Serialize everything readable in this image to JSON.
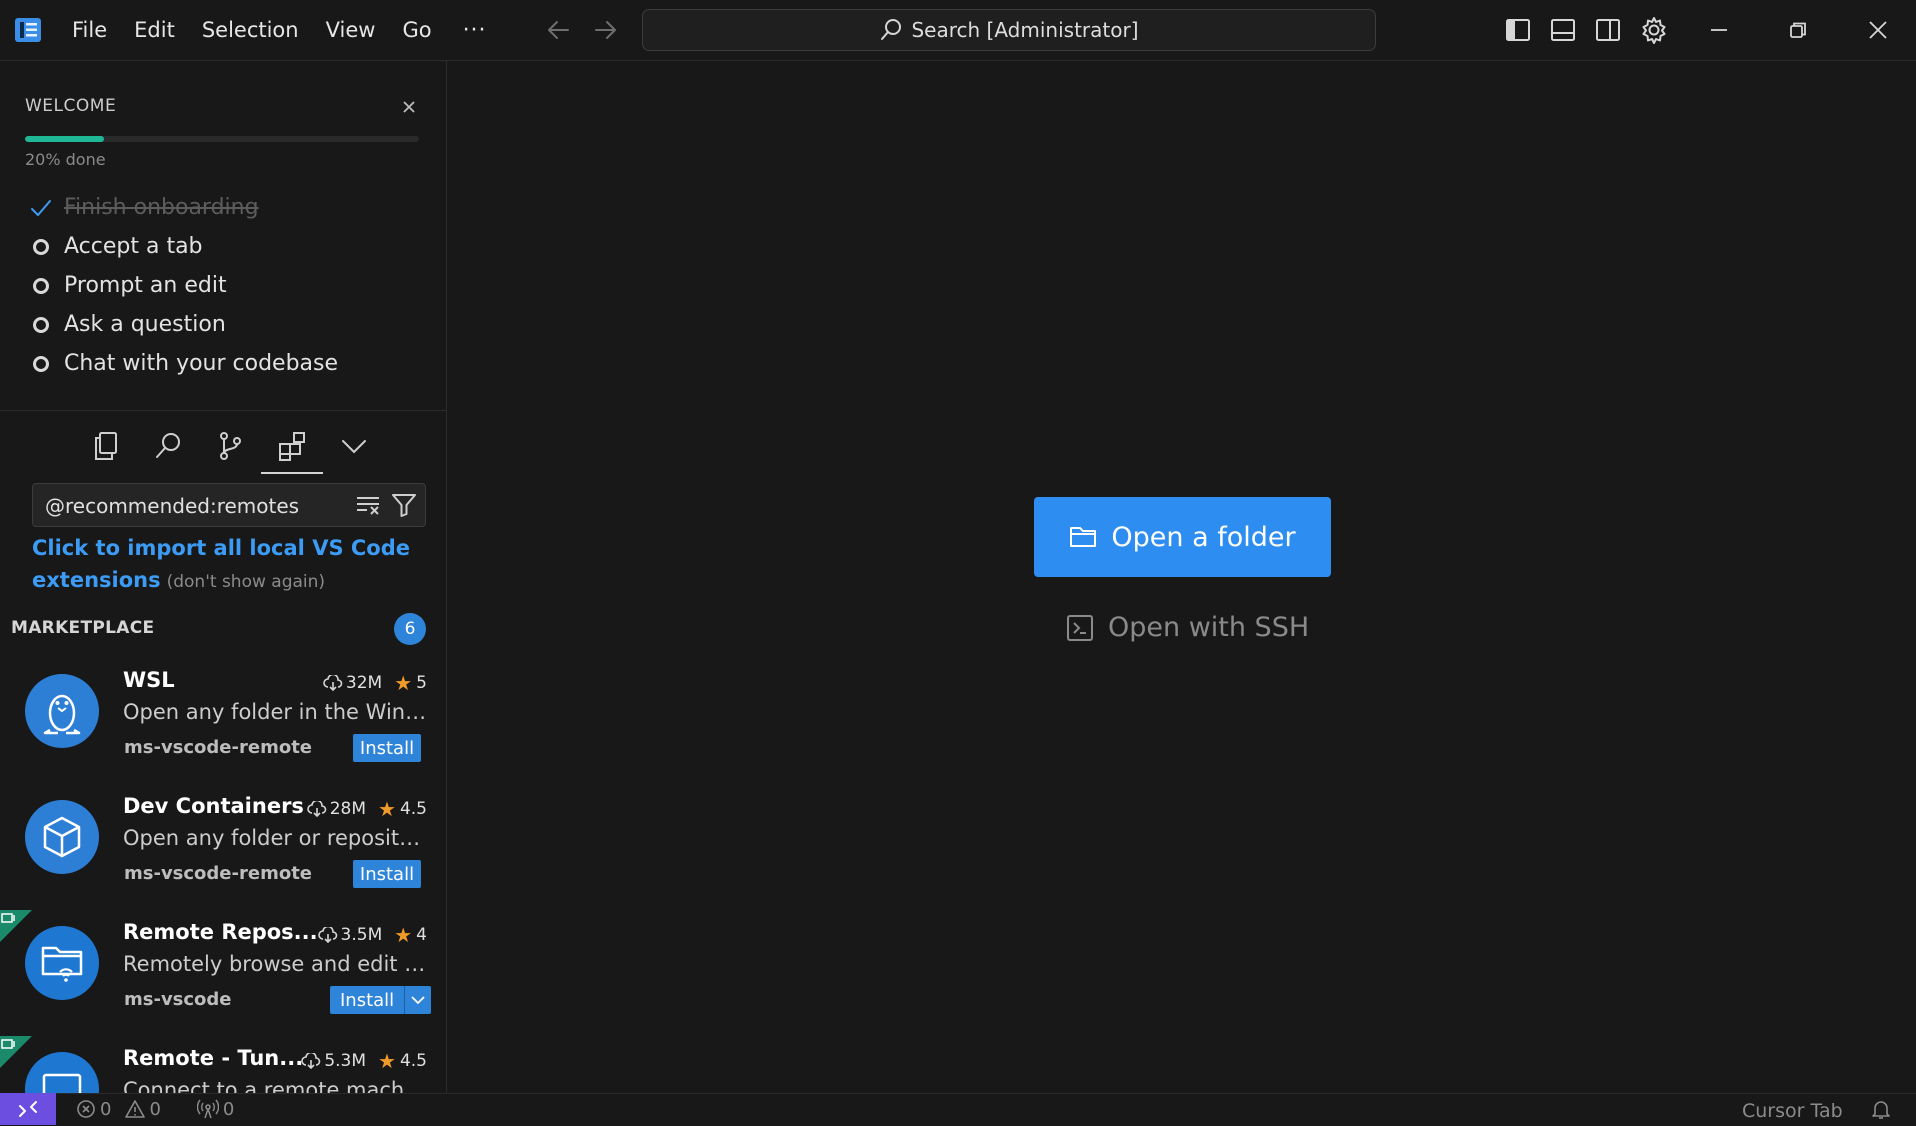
{
  "titlebar": {
    "menu": [
      "File",
      "Edit",
      "Selection",
      "View",
      "Go"
    ],
    "more": "···",
    "search": "Search [Administrator]"
  },
  "welcome": {
    "title": "WELCOME",
    "progress_percent": 20,
    "progress_text": "20% done",
    "checklist": [
      {
        "label": "Finish onboarding",
        "done": true
      },
      {
        "label": "Accept a tab",
        "done": false
      },
      {
        "label": "Prompt an edit",
        "done": false
      },
      {
        "label": "Ask a question",
        "done": false
      },
      {
        "label": "Chat with your codebase",
        "done": false
      }
    ]
  },
  "extensions": {
    "search_value": "@recommended:remotes",
    "import_link": "Click to import all local VS Code extensions",
    "dont_show": "(don't show again)",
    "section_title": "MARKETPLACE",
    "count": "6",
    "items": [
      {
        "name": "WSL",
        "downloads": "32M",
        "rating": "5",
        "description": "Open any folder in the Windows Subsystem for Linux",
        "publisher": "ms-vscode-remote",
        "install": "Install",
        "icon": "linux-penguin-icon"
      },
      {
        "name": "Dev Containers",
        "downloads": "28M",
        "rating": "4.5",
        "description": "Open any folder or repository inside a Docker container",
        "publisher": "ms-vscode-remote",
        "install": "Install",
        "icon": "container-box-icon"
      },
      {
        "name": "Remote Repos...",
        "downloads": "3.5M",
        "rating": "4",
        "description": "Remotely browse and edit git repositories",
        "publisher": "ms-vscode",
        "install": "Install",
        "icon": "remote-folder-icon"
      },
      {
        "name": "Remote - Tun...",
        "downloads": "5.3M",
        "rating": "4.5",
        "description": "Connect to a remote machine through a tunnel",
        "publisher": "",
        "install": "",
        "icon": "monitor-icon"
      }
    ]
  },
  "editor": {
    "open_folder": "Open a folder",
    "open_ssh": "Open with SSH"
  },
  "statusbar": {
    "errors": "0",
    "warnings": "0",
    "ports": "0",
    "cursor_tab": "Cursor Tab"
  },
  "colors": {
    "accent": "#2d8df0",
    "progress": "#1fb896",
    "remote": "#6c4ee0",
    "link": "#3c9cf5",
    "star": "#f09a29"
  }
}
